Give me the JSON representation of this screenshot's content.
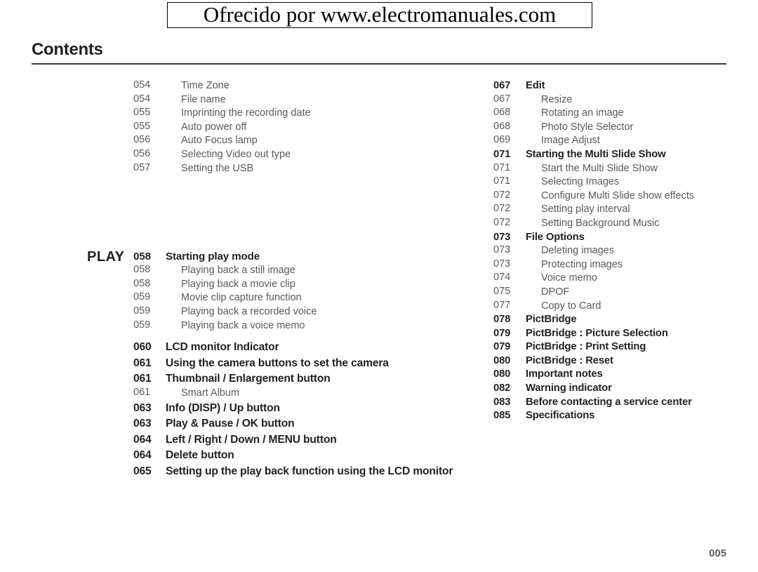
{
  "banner": {
    "text": "Ofrecido por www.electromanuales.com"
  },
  "header": {
    "title": "Contents"
  },
  "footer": {
    "page_number": "005"
  },
  "mode_labels": {
    "play": "PLAY"
  },
  "left_column": {
    "top_group": [
      {
        "page": "054",
        "title": "Time Zone",
        "level": "sub"
      },
      {
        "page": "054",
        "title": "File name",
        "level": "sub"
      },
      {
        "page": "055",
        "title": "Imprinting the recording date",
        "level": "sub"
      },
      {
        "page": "055",
        "title": "Auto power off",
        "level": "sub"
      },
      {
        "page": "056",
        "title": "Auto Focus lamp",
        "level": "sub"
      },
      {
        "page": "056",
        "title": "Selecting Video out type",
        "level": "sub"
      },
      {
        "page": "057",
        "title": "Setting the USB",
        "level": "sub"
      }
    ],
    "play_group": [
      {
        "page": "058",
        "title": "Starting play mode",
        "level": "main"
      },
      {
        "page": "058",
        "title": "Playing back a still image",
        "level": "sub"
      },
      {
        "page": "058",
        "title": "Playing back a movie clip",
        "level": "sub"
      },
      {
        "page": "059",
        "title": "Movie clip capture function",
        "level": "sub"
      },
      {
        "page": "059",
        "title": "Playing back a recorded voice",
        "level": "sub"
      },
      {
        "page": "059",
        "title": "Playing back a voice memo",
        "level": "sub"
      }
    ],
    "buttons_group": [
      {
        "page": "060",
        "title": "LCD monitor Indicator",
        "level": "main"
      },
      {
        "page": "061",
        "title": "Using the camera buttons to set the camera",
        "level": "main"
      },
      {
        "page": "061",
        "title": "Thumbnail / Enlargement button",
        "level": "main"
      },
      {
        "page": "061",
        "title": "Smart Album",
        "level": "sub"
      },
      {
        "page": "063",
        "title": "Info (DISP) / Up button",
        "level": "main"
      },
      {
        "page": "063",
        "title": "Play & Pause / OK button",
        "level": "main"
      },
      {
        "page": "064",
        "title": "Left / Right / Down / MENU button",
        "level": "main"
      },
      {
        "page": "064",
        "title": "Delete button",
        "level": "main"
      },
      {
        "page": "065",
        "title": "Setting up the play back function using the LCD monitor",
        "level": "main"
      }
    ]
  },
  "right_column": {
    "edit_group": [
      {
        "page": "067",
        "title": "Edit",
        "level": "main"
      },
      {
        "page": "067",
        "title": "Resize",
        "level": "sub"
      },
      {
        "page": "068",
        "title": "Rotating an image",
        "level": "sub"
      },
      {
        "page": "068",
        "title": "Photo Style Selector",
        "level": "sub"
      },
      {
        "page": "069",
        "title": "Image Adjust",
        "level": "sub"
      }
    ],
    "slideshow_group": [
      {
        "page": "071",
        "title": "Starting the Multi Slide Show",
        "level": "main"
      },
      {
        "page": "071",
        "title": "Start the Multi Slide Show",
        "level": "sub"
      },
      {
        "page": "071",
        "title": "Selecting Images",
        "level": "sub"
      },
      {
        "page": "072",
        "title": "Configure Multi Slide show effects",
        "level": "sub"
      },
      {
        "page": "072",
        "title": "Setting play interval",
        "level": "sub"
      },
      {
        "page": "072",
        "title": "Setting Background Music",
        "level": "sub"
      }
    ],
    "fileoptions_group": [
      {
        "page": "073",
        "title": "File Options",
        "level": "main"
      },
      {
        "page": "073",
        "title": "Deleting images",
        "level": "sub"
      },
      {
        "page": "073",
        "title": "Protecting images",
        "level": "sub"
      },
      {
        "page": "074",
        "title": "Voice memo",
        "level": "sub"
      },
      {
        "page": "075",
        "title": "DPOF",
        "level": "sub"
      },
      {
        "page": "077",
        "title": "Copy to Card",
        "level": "sub"
      }
    ],
    "pictbridge_group": [
      {
        "page": "078",
        "title": "PictBridge",
        "level": "main"
      },
      {
        "page": "079",
        "title": "PictBridge : Picture Selection",
        "level": "main"
      },
      {
        "page": "079",
        "title": "PictBridge : Print Setting",
        "level": "main"
      },
      {
        "page": "080",
        "title": "PictBridge : Reset",
        "level": "main"
      },
      {
        "page": "080",
        "title": "Important notes",
        "level": "main"
      },
      {
        "page": "082",
        "title": "Warning indicator",
        "level": "main"
      },
      {
        "page": "083",
        "title": "Before contacting a service center",
        "level": "main"
      },
      {
        "page": "085",
        "title": "Specifications",
        "level": "main"
      }
    ]
  }
}
